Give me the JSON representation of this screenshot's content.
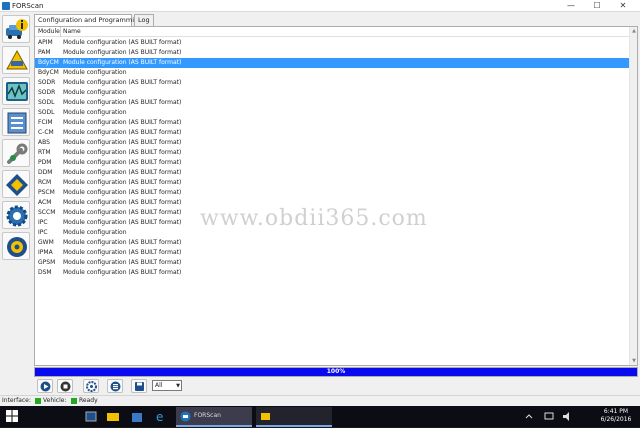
{
  "window": {
    "title": "FORScan",
    "minimize": "—",
    "maximize": "☐",
    "close": "✕"
  },
  "tabs": [
    {
      "label": "Configuration and Programming",
      "active": true
    },
    {
      "label": "Log",
      "active": false
    }
  ],
  "list": {
    "columns": [
      "Module",
      "Name"
    ],
    "selected_index": 2,
    "rows": [
      {
        "module": "APIM",
        "name": "Module configuration (AS BUILT format)"
      },
      {
        "module": "PAM",
        "name": "Module configuration (AS BUILT format)"
      },
      {
        "module": "BdyCM",
        "name": "Module configuration (AS BUILT format)"
      },
      {
        "module": "BdyCM",
        "name": "Module configuration"
      },
      {
        "module": "SODR",
        "name": "Module configuration (AS BUILT format)"
      },
      {
        "module": "SODR",
        "name": "Module configuration"
      },
      {
        "module": "SODL",
        "name": "Module configuration (AS BUILT format)"
      },
      {
        "module": "SODL",
        "name": "Module configuration"
      },
      {
        "module": "FCIM",
        "name": "Module configuration (AS BUILT format)"
      },
      {
        "module": "C-CM",
        "name": "Module configuration (AS BUILT format)"
      },
      {
        "module": "ABS",
        "name": "Module configuration (AS BUILT format)"
      },
      {
        "module": "RTM",
        "name": "Module configuration (AS BUILT format)"
      },
      {
        "module": "PDM",
        "name": "Module configuration (AS BUILT format)"
      },
      {
        "module": "DDM",
        "name": "Module configuration (AS BUILT format)"
      },
      {
        "module": "RCM",
        "name": "Module configuration (AS BUILT format)"
      },
      {
        "module": "PSCM",
        "name": "Module configuration (AS BUILT format)"
      },
      {
        "module": "ACM",
        "name": "Module configuration (AS BUILT format)"
      },
      {
        "module": "SCCM",
        "name": "Module configuration (AS BUILT format)"
      },
      {
        "module": "IPC",
        "name": "Module configuration (AS BUILT format)"
      },
      {
        "module": "IPC",
        "name": "Module configuration"
      },
      {
        "module": "GWM",
        "name": "Module configuration (AS BUILT format)"
      },
      {
        "module": "IPMA",
        "name": "Module configuration (AS BUILT format)"
      },
      {
        "module": "GPSM",
        "name": "Module configuration (AS BUILT format)"
      },
      {
        "module": "DSM",
        "name": "Module configuration (AS BUILT format)"
      }
    ]
  },
  "watermark": "www.obdii365.com",
  "progress": {
    "value": 1.0,
    "text": "100%",
    "color": "#0a0aee"
  },
  "bottom_toolbar": {
    "buttons": [
      "play-icon",
      "stop-icon",
      "settings-gear-icon",
      "list-icon",
      "save-icon"
    ],
    "filter_value": "All"
  },
  "status": {
    "interface_label": "Interface:",
    "vehicle_label": "Vehicle:",
    "state": "Ready",
    "indicator_color": "#22a822"
  },
  "left_toolbar": [
    "vehicle-info-icon",
    "dtc-icon",
    "oscilloscope-icon",
    "checklist-icon",
    "wrench-icon",
    "chip-icon",
    "gear-icon",
    "support-icon"
  ],
  "taskbar": {
    "app_label": "FORScan",
    "clock_time": "6:41 PM",
    "clock_date": "6/26/2016"
  },
  "colors": {
    "selection": "#3399ff",
    "accent": "#1e73be"
  }
}
